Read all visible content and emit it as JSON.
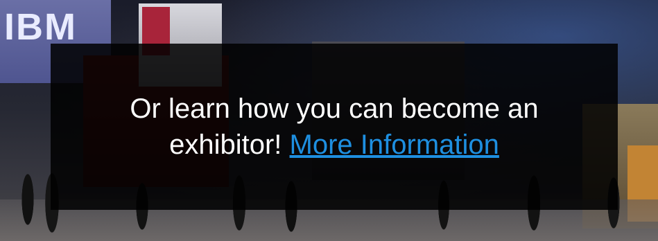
{
  "background": {
    "logo_text": "IBM"
  },
  "overlay": {
    "message": "Or learn how you can become an exhibitor!",
    "link_label": "More Information",
    "link_color": "#1e8fe0",
    "text_color": "#ffffff"
  }
}
